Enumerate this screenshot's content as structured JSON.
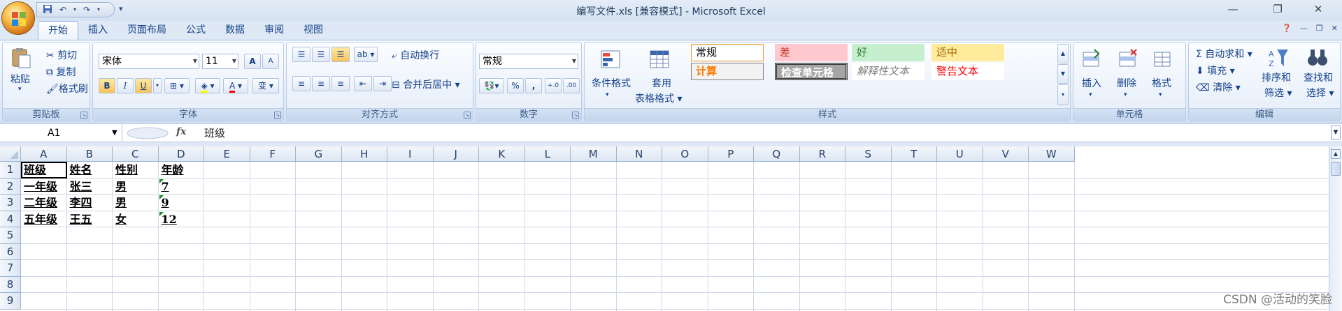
{
  "window": {
    "title": "编写文件.xls  [兼容模式] - Microsoft Excel",
    "controls": {
      "minimize": "—",
      "restore": "❐",
      "close": "✕"
    }
  },
  "qat": {
    "save_icon": "save-icon",
    "undo_icon": "undo-icon",
    "redo_icon": "redo-icon",
    "more": "▾"
  },
  "tabs": [
    "开始",
    "插入",
    "页面布局",
    "公式",
    "数据",
    "审阅",
    "视图"
  ],
  "ribbon": {
    "clipboard": {
      "label": "剪贴板",
      "paste": "粘贴",
      "cut": "剪切",
      "copy": "复制",
      "format_painter": "格式刷"
    },
    "font": {
      "label": "字体",
      "family": "宋体",
      "size": "11",
      "grow": "A",
      "shrink": "A",
      "bold": "B",
      "italic": "I",
      "underline": "U",
      "phonetic": "变"
    },
    "alignment": {
      "label": "对齐方式",
      "wrap_text": "自动换行",
      "merge_center": "合并后居中"
    },
    "number": {
      "label": "数字",
      "format": "常规",
      "percent": "%",
      "comma": ","
    },
    "styles": {
      "label": "样式",
      "conditional_formatting": "条件格式",
      "format_as_table_1": "套用",
      "format_as_table_2": "表格格式",
      "cells": [
        {
          "text": "常规",
          "bg": "#ffffff",
          "color": "#000000",
          "border": "#e69a2e"
        },
        {
          "text": "差",
          "bg": "#ffc7ce",
          "color": "#c0392b",
          "border": "#ffc7ce"
        },
        {
          "text": "好",
          "bg": "#c6efce",
          "color": "#2e7d32",
          "border": "#c6efce"
        },
        {
          "text": "适中",
          "bg": "#ffeb9c",
          "color": "#9c6500",
          "border": "#ffeb9c"
        },
        {
          "text": "计算",
          "bg": "#f2f2f2",
          "color": "#fa7d00",
          "border": "#7f7f7f"
        },
        {
          "text": "检查单元格",
          "bg": "#a5a5a5",
          "color": "#ffffff",
          "border": "#3f3f3f"
        },
        {
          "text": "解释性文本",
          "bg": "#ffffff",
          "color": "#7f7f7f",
          "border": "#ffffff"
        },
        {
          "text": "警告文本",
          "bg": "#ffffff",
          "color": "#ff0000",
          "border": "#ffffff"
        }
      ]
    },
    "cells": {
      "label": "单元格",
      "insert": "插入",
      "delete": "删除",
      "format": "格式"
    },
    "editing": {
      "label": "编辑",
      "autosum": "自动求和",
      "fill": "填充",
      "clear": "清除",
      "sort_filter_1": "排序和",
      "sort_filter_2": "筛选",
      "find_select_1": "查找和",
      "find_select_2": "选择"
    }
  },
  "formula_bar": {
    "name_box": "A1",
    "fx": "fx",
    "content": "班级"
  },
  "sheet": {
    "columns": [
      "A",
      "B",
      "C",
      "D",
      "E",
      "F",
      "G",
      "H",
      "I",
      "J",
      "K",
      "L",
      "M",
      "N",
      "O",
      "P",
      "Q",
      "R",
      "S",
      "T",
      "U",
      "V",
      "W"
    ],
    "rows": [
      "1",
      "2",
      "3",
      "4",
      "5",
      "6",
      "7",
      "8",
      "9"
    ],
    "cells": [
      [
        "班级",
        "姓名",
        "性别",
        "年龄"
      ],
      [
        "一年级",
        "张三",
        "男",
        "7"
      ],
      [
        "二年级",
        "李四",
        "男",
        "9"
      ],
      [
        "五年级",
        "王五",
        "女",
        "12"
      ]
    ]
  },
  "watermark": "CSDN @活动的笑脸"
}
